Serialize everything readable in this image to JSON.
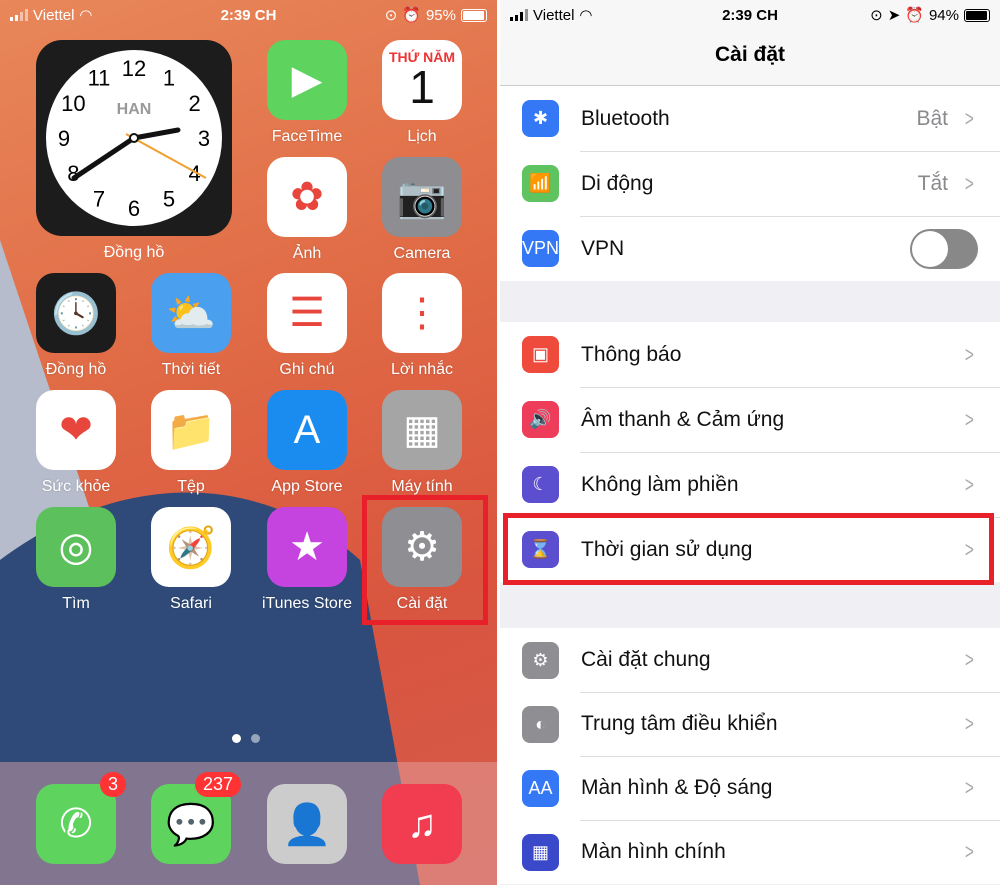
{
  "home": {
    "status": {
      "carrier": "Viettel",
      "time": "2:39 CH",
      "battery": "95%"
    },
    "clock_widget": {
      "city": "HAN",
      "label": "Đồng hồ",
      "numbers": [
        "12",
        "1",
        "2",
        "3",
        "4",
        "5",
        "6",
        "7",
        "8",
        "9",
        "10",
        "11"
      ]
    },
    "calendar": {
      "weekday": "THỨ NĂM",
      "day": "1"
    },
    "apps": [
      {
        "label": "FaceTime",
        "icon": "facetime-icon"
      },
      {
        "label": "Lịch",
        "icon": "calendar-icon"
      },
      {
        "label": "Ảnh",
        "icon": "photos-icon"
      },
      {
        "label": "Camera",
        "icon": "camera-icon"
      },
      {
        "label": "Đồng hồ",
        "icon": "clock-icon"
      },
      {
        "label": "Thời tiết",
        "icon": "weather-icon"
      },
      {
        "label": "Ghi chú",
        "icon": "notes-icon"
      },
      {
        "label": "Lời nhắc",
        "icon": "reminders-icon"
      },
      {
        "label": "Sức khỏe",
        "icon": "health-icon"
      },
      {
        "label": "Tệp",
        "icon": "files-icon"
      },
      {
        "label": "App Store",
        "icon": "appstore-icon"
      },
      {
        "label": "Máy tính",
        "icon": "calculator-icon"
      },
      {
        "label": "Tìm",
        "icon": "findmy-icon"
      },
      {
        "label": "Safari",
        "icon": "safari-icon"
      },
      {
        "label": "iTunes Store",
        "icon": "itunes-icon"
      },
      {
        "label": "Cài đặt",
        "icon": "settings-icon"
      }
    ],
    "dock": [
      {
        "icon": "phone-icon",
        "badge": "3"
      },
      {
        "icon": "messages-icon",
        "badge": "237"
      },
      {
        "icon": "contacts-icon"
      },
      {
        "icon": "music-icon"
      }
    ]
  },
  "settings": {
    "status": {
      "carrier": "Viettel",
      "time": "2:39 CH",
      "battery": "94%"
    },
    "title": "Cài đặt",
    "group1": [
      {
        "label": "Bluetooth",
        "value": "Bật",
        "color": "#3478f6"
      },
      {
        "label": "Di động",
        "value": "Tắt",
        "color": "#5fc35f"
      },
      {
        "label": "VPN",
        "icon_text": "VPN",
        "toggle": false,
        "color": "#3478f6"
      }
    ],
    "group2": [
      {
        "label": "Thông báo",
        "color": "#ee4b3d"
      },
      {
        "label": "Âm thanh & Cảm ứng",
        "color": "#ee3d5a"
      },
      {
        "label": "Không làm phiền",
        "color": "#5b4fd0"
      },
      {
        "label": "Thời gian sử dụng",
        "color": "#5b4fd0"
      }
    ],
    "group3": [
      {
        "label": "Cài đặt chung",
        "color": "#8e8e93"
      },
      {
        "label": "Trung tâm điều khiển",
        "color": "#8e8e93"
      },
      {
        "label": "Màn hình & Độ sáng",
        "icon_text": "AA",
        "color": "#3478f6"
      },
      {
        "label": "Màn hình chính",
        "color": "#3a49c9"
      }
    ]
  },
  "highlight_color": "#e8202a"
}
